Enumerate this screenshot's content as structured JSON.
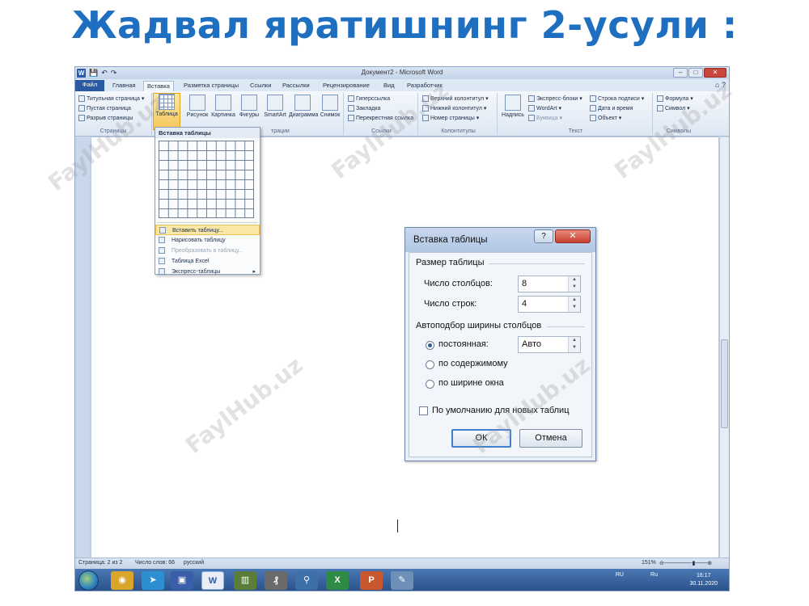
{
  "slide_title": "Жадвал яратишнинг 2-усули :",
  "window": {
    "title": "Документ2 - Microsoft Word",
    "logo": "W",
    "qat_save": "💾",
    "qat_undo": "↶",
    "qat_redo": "↷",
    "minimize": "–",
    "maximize": "□",
    "close": "✕"
  },
  "tabs": [
    {
      "label": "Файл"
    },
    {
      "label": "Главная"
    },
    {
      "label": "Вставка"
    },
    {
      "label": "Разметка страницы"
    },
    {
      "label": "Ссылки"
    },
    {
      "label": "Рассылки"
    },
    {
      "label": "Рецензирование"
    },
    {
      "label": "Вид"
    },
    {
      "label": "Разработчик"
    }
  ],
  "tab_help": "⌂ ?",
  "ribbon": {
    "pages": {
      "label": "Страницы",
      "items": [
        "Титульная страница ▾",
        "Пустая страница",
        "Разрыв страницы"
      ]
    },
    "tables": {
      "table_button": "Таблица"
    },
    "illustrations": {
      "buttons": [
        "Рисунок",
        "Картинка",
        "Фигуры",
        "SmartArt",
        "Диаграмма",
        "Снимок"
      ],
      "label_fragment": "трации"
    },
    "links": {
      "label": "Ссылки",
      "items": [
        "Гиперссылка",
        "Закладка",
        "Перекрестная ссылка"
      ]
    },
    "headers": {
      "label": "Колонтитулы",
      "items": [
        "Верхний колонтитул ▾",
        "Нижний колонтитул ▾",
        "Номер страницы ▾"
      ]
    },
    "text": {
      "label": "Текст",
      "textbox": "Надпись",
      "items_col1": [
        "Экспресс-блоки ▾",
        "WordArt ▾",
        "Буквица ▾"
      ],
      "items_col2": [
        "Строка подписи ▾",
        "Дата и время",
        "Объект ▾"
      ]
    },
    "symbols": {
      "label": "Символы",
      "items": [
        "Формула ▾",
        "Символ ▾"
      ]
    }
  },
  "dropdown": {
    "title": "Вставка таблицы",
    "items": [
      {
        "label": "Вставить таблицу..."
      },
      {
        "label": "Нарисовать таблицу"
      },
      {
        "label": "Преобразовать в таблицу..."
      },
      {
        "label": "Таблица Excel"
      },
      {
        "label": "Экспресс-таблицы"
      }
    ]
  },
  "dialog": {
    "title": "Вставка таблицы",
    "help": "?",
    "close": "✕",
    "size_section": "Размер таблицы",
    "columns_label": "Число столбцов:",
    "columns_value": "8",
    "rows_label": "Число строк:",
    "rows_value": "4",
    "autofit_section": "Автоподбор ширины столбцов",
    "fixed_label": "постоянная:",
    "fixed_value": "Авто",
    "content_label": "по содержимому",
    "window_label": "по ширине окна",
    "default_label": "По умолчанию для новых таблиц",
    "ok": "ОК",
    "cancel": "Отмена"
  },
  "statusbar": {
    "page": "Страница: 2 из 2",
    "words": "Число слов: 66",
    "language": "русский",
    "zoom": "151%"
  },
  "taskbar": {
    "tray_lang": "RU",
    "tray_lang2": "Ru",
    "time": "16:17",
    "date": "30.11.2020"
  },
  "watermark": "FaylHub.uz"
}
